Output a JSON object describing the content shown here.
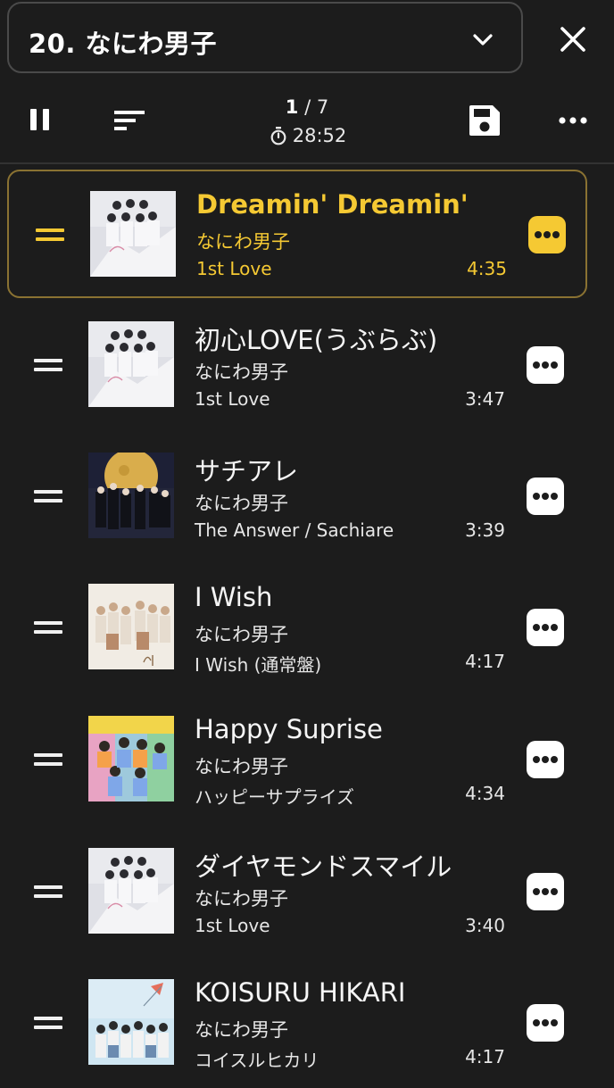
{
  "header": {
    "playlist_title": "20. なにわ男子"
  },
  "toolbar": {
    "current_index": "1",
    "separator": "/",
    "total": "7",
    "total_duration": "28:52"
  },
  "colors": {
    "background": "#1c1c1c",
    "accent": "#f5c933",
    "active_border": "#8a7232"
  },
  "tracks": [
    {
      "title": "Dreamin' Dreamin'",
      "artist": "なにわ男子",
      "album": "1st Love",
      "duration": "4:35",
      "active": true
    },
    {
      "title": "初心LOVE(うぶらぶ)",
      "artist": "なにわ男子",
      "album": "1st Love",
      "duration": "3:47",
      "active": false
    },
    {
      "title": "サチアレ",
      "artist": "なにわ男子",
      "album": "The Answer / Sachiare",
      "duration": "3:39",
      "active": false
    },
    {
      "title": "I Wish",
      "artist": "なにわ男子",
      "album": "I Wish (通常盤)",
      "duration": "4:17",
      "active": false
    },
    {
      "title": "Happy Suprise",
      "artist": "なにわ男子",
      "album": "ハッピーサプライズ",
      "duration": "4:34",
      "active": false
    },
    {
      "title": "ダイヤモンドスマイル",
      "artist": "なにわ男子",
      "album": "1st Love",
      "duration": "3:40",
      "active": false
    },
    {
      "title": "KOISURU HIKARI",
      "artist": "なにわ男子",
      "album": "コイスルヒカリ",
      "duration": "4:17",
      "active": false
    }
  ]
}
